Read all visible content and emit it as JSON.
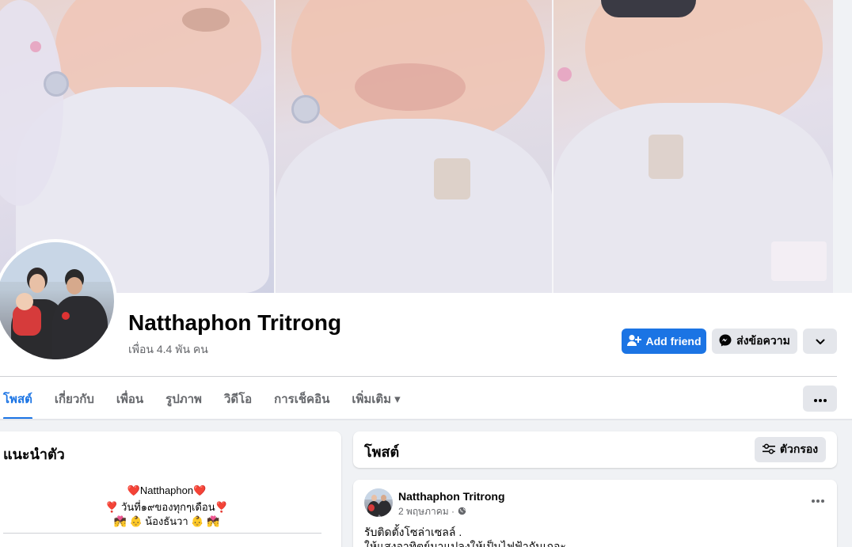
{
  "profile": {
    "name": "Natthaphon Tritrong",
    "friends_count": "เพื่อน 4.4 พัน คน"
  },
  "actions": {
    "add_friend": "Add friend",
    "message": "ส่งข้อความ"
  },
  "tabs": [
    {
      "label": "โพสต์",
      "active": true
    },
    {
      "label": "เกี่ยวกับ",
      "active": false
    },
    {
      "label": "เพื่อน",
      "active": false
    },
    {
      "label": "รูปภาพ",
      "active": false
    },
    {
      "label": "วิดีโอ",
      "active": false
    },
    {
      "label": "การเช็คอิน",
      "active": false
    },
    {
      "label": "เพิ่มเติม ▾",
      "active": false
    }
  ],
  "intro": {
    "title": "แนะนำตัว",
    "bio_lines": [
      "❤️Natthaphon❤️",
      "❣️ วันที่๑๙ของทุกๆเดือน❣️",
      "💏 👶 น้องธันวา 👶 💏"
    ]
  },
  "posts_section": {
    "title": "โพสต์",
    "filter_label": "ตัวกรอง"
  },
  "post": {
    "author": "Natthaphon Tritrong",
    "date": "2 พฤษภาคม ·",
    "text_lines": [
      "รับติดตั้งโซล่าเซลล์ .",
      "ให้แสงอาทิตย์มาแปลงให้เป็นไฟฟ้ากันเถอะ"
    ]
  },
  "colors": {
    "accent": "#1b74e4",
    "secondary_button": "#e4e6eb",
    "page_background": "#f0f2f5"
  },
  "icons": {
    "add_friend": "person-add-icon",
    "message": "messenger-icon",
    "more": "chevron-down-icon",
    "filter": "sliders-icon",
    "audience": "globe-icon",
    "options": "more-horizontal-icon"
  }
}
